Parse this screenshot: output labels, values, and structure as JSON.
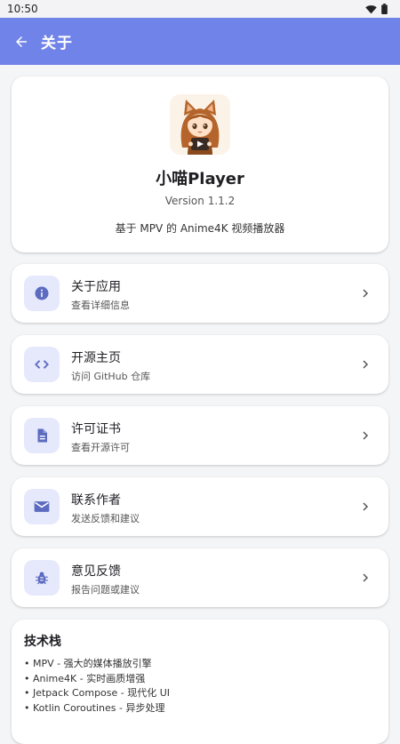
{
  "status_bar": {
    "time": "10:50"
  },
  "app_bar": {
    "title": "关于"
  },
  "header": {
    "app_name": "小喵Player",
    "version": "Version 1.1.2",
    "description": "基于 MPV 的 Anime4K 视频播放器"
  },
  "menu": [
    {
      "title": "关于应用",
      "subtitle": "查看详细信息",
      "icon": "info-icon"
    },
    {
      "title": "开源主页",
      "subtitle": "访问 GitHub 仓库",
      "icon": "code-icon"
    },
    {
      "title": "许可证书",
      "subtitle": "查看开源许可",
      "icon": "document-icon"
    },
    {
      "title": "联系作者",
      "subtitle": "发送反馈和建议",
      "icon": "mail-icon"
    },
    {
      "title": "意见反馈",
      "subtitle": "报告问题或建议",
      "icon": "bug-icon"
    }
  ],
  "tech_stack": {
    "title": "技术栈",
    "items": [
      "• MPV - 强大的媒体播放引擎",
      "• Anime4K - 实时画质增强",
      "• Jetpack Compose - 现代化 UI",
      "• Kotlin Coroutines - 异步处理"
    ]
  },
  "colors": {
    "app_bar": "#7083e8",
    "icon_tint": "#5c6bc0",
    "icon_bg": "#e6e9fb",
    "background": "#f4f5f7"
  }
}
